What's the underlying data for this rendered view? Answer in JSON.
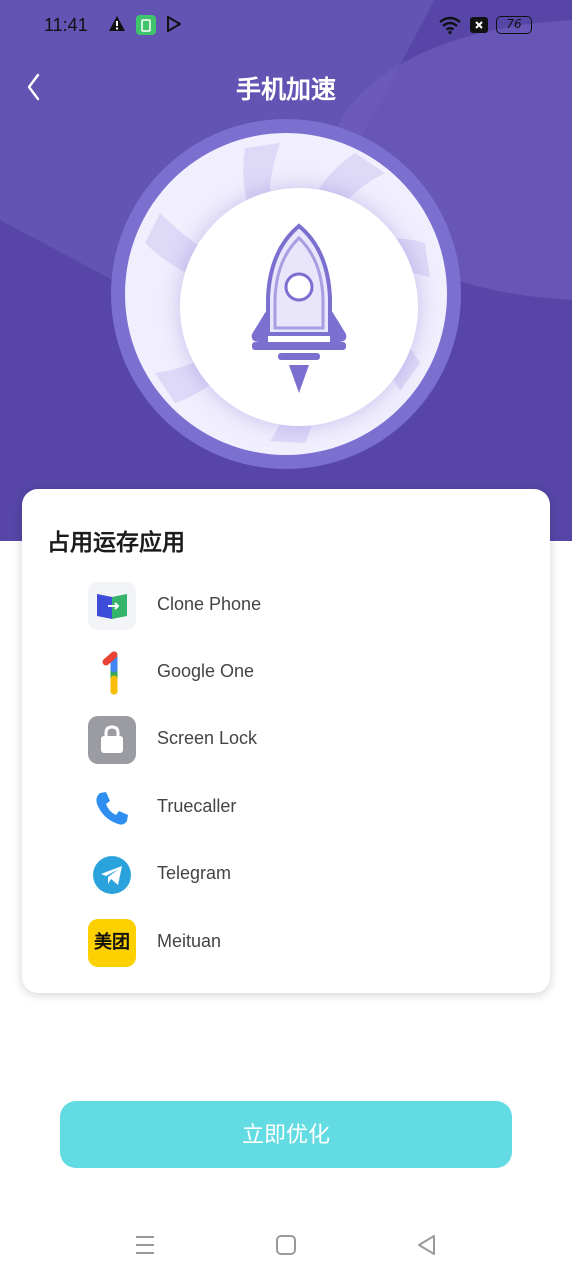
{
  "status_bar": {
    "time": "11:41",
    "battery": "76",
    "icons": [
      "warning-icon",
      "app-notification-icon",
      "play-store-icon",
      "wifi-icon",
      "sim-icon",
      "battery-icon"
    ]
  },
  "header": {
    "title": "手机加速",
    "back_icon": "chevron-left-icon"
  },
  "hero": {
    "icon": "rocket-icon",
    "colors": {
      "background": "#5746a8",
      "ring": "#7b6fd0",
      "rocket": "#7b6fd0"
    }
  },
  "card": {
    "title": "占用运存应用",
    "apps": [
      {
        "label": "Clone Phone",
        "icon": "clone-phone-icon"
      },
      {
        "label": "Google One",
        "icon": "google-one-icon"
      },
      {
        "label": "Screen Lock",
        "icon": "lock-icon"
      },
      {
        "label": "Truecaller",
        "icon": "phone-icon"
      },
      {
        "label": "Telegram",
        "icon": "telegram-icon"
      },
      {
        "label": "Meituan",
        "icon": "meituan-icon",
        "icon_text": "美团"
      }
    ]
  },
  "actions": {
    "optimize_label": "立即优化",
    "optimize_color": "#63dbe3"
  },
  "nav_bar": {
    "icons": [
      "menu-icon",
      "home-icon",
      "back-icon"
    ]
  }
}
